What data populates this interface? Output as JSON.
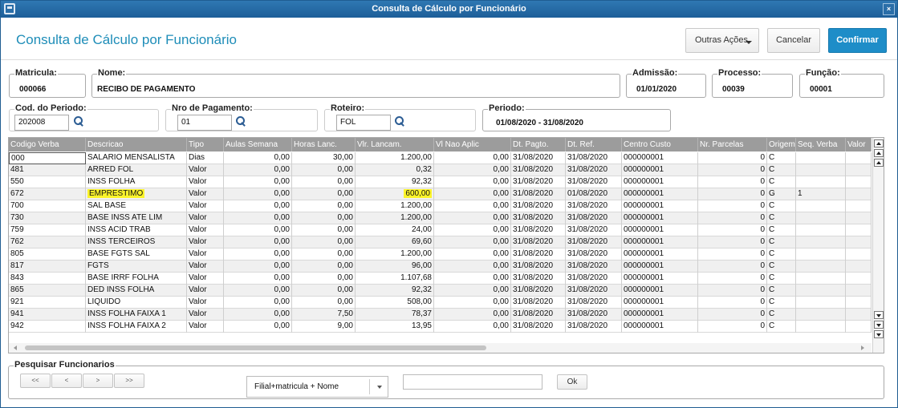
{
  "window": {
    "title": "Consulta de Cálculo por Funcionário",
    "close_glyph": "×",
    "app_icon": "window-icon"
  },
  "header": {
    "title": "Consulta de Cálculo por Funcionário",
    "outras_acoes_label": "Outras Ações",
    "cancelar_label": "Cancelar",
    "confirmar_label": "Confirmar",
    "accent_color": "#1e8dc8"
  },
  "employee": {
    "matricula": {
      "label": "Matricula:",
      "value": "000066"
    },
    "nome": {
      "label": "Nome:",
      "value": "RECIBO DE PAGAMENTO"
    },
    "admissao": {
      "label": "Admissão:",
      "value": "01/01/2020"
    },
    "processo": {
      "label": "Processo:",
      "value": "00039"
    },
    "funcao": {
      "label": "Função:",
      "value": "00001"
    }
  },
  "filters": {
    "cod_periodo": {
      "label": "Cod. do Periodo:",
      "value": "202008"
    },
    "nro_pagamento": {
      "label": "Nro de Pagamento:",
      "value": "01"
    },
    "roteiro": {
      "label": "Roteiro:",
      "value": "FOL"
    },
    "periodo": {
      "label": "Periodo:",
      "value": "01/08/2020 - 31/08/2020"
    }
  },
  "grid": {
    "columns": [
      "Codigo Verba",
      "Descricao",
      "Tipo",
      "Aulas Semana",
      "Horas Lanc.",
      "Vlr. Lancam.",
      "Vl Nao Aplic",
      "Dt. Pagto.",
      "Dt. Ref.",
      "Centro Custo",
      "Nr. Parcelas",
      "Origem",
      "Seq. Verba",
      "Valor"
    ],
    "highlight_color": "#fbf42a",
    "rows": [
      {
        "codigo": "000",
        "descricao": "SALARIO MENSALISTA",
        "tipo": "Dias",
        "aulas": "0,00",
        "horas": "30,00",
        "vlr": "1.200,00",
        "vlnao": "0,00",
        "dtpagto": "31/08/2020",
        "dtref": "31/08/2020",
        "centro": "000000001",
        "parcelas": "0",
        "origem": "C",
        "seq": "",
        "highlight": false
      },
      {
        "codigo": "481",
        "descricao": "ARRED FOL",
        "tipo": "Valor",
        "aulas": "0,00",
        "horas": "0,00",
        "vlr": "0,32",
        "vlnao": "0,00",
        "dtpagto": "31/08/2020",
        "dtref": "31/08/2020",
        "centro": "000000001",
        "parcelas": "0",
        "origem": "C",
        "seq": "",
        "highlight": false
      },
      {
        "codigo": "550",
        "descricao": "INSS FOLHA",
        "tipo": "Valor",
        "aulas": "0,00",
        "horas": "0,00",
        "vlr": "92,32",
        "vlnao": "0,00",
        "dtpagto": "31/08/2020",
        "dtref": "31/08/2020",
        "centro": "000000001",
        "parcelas": "0",
        "origem": "C",
        "seq": "",
        "highlight": false
      },
      {
        "codigo": "672",
        "descricao": "EMPRESTIMO",
        "tipo": "Valor",
        "aulas": "0,00",
        "horas": "0,00",
        "vlr": "600,00",
        "vlnao": "0,00",
        "dtpagto": "31/08/2020",
        "dtref": "01/08/2020",
        "centro": "000000001",
        "parcelas": "0",
        "origem": "G",
        "seq": "1",
        "highlight": true
      },
      {
        "codigo": "700",
        "descricao": "SAL BASE",
        "tipo": "Valor",
        "aulas": "0,00",
        "horas": "0,00",
        "vlr": "1.200,00",
        "vlnao": "0,00",
        "dtpagto": "31/08/2020",
        "dtref": "31/08/2020",
        "centro": "000000001",
        "parcelas": "0",
        "origem": "C",
        "seq": "",
        "highlight": false
      },
      {
        "codigo": "730",
        "descricao": "BASE INSS ATE LIM",
        "tipo": "Valor",
        "aulas": "0,00",
        "horas": "0,00",
        "vlr": "1.200,00",
        "vlnao": "0,00",
        "dtpagto": "31/08/2020",
        "dtref": "31/08/2020",
        "centro": "000000001",
        "parcelas": "0",
        "origem": "C",
        "seq": "",
        "highlight": false
      },
      {
        "codigo": "759",
        "descricao": "INSS ACID TRAB",
        "tipo": "Valor",
        "aulas": "0,00",
        "horas": "0,00",
        "vlr": "24,00",
        "vlnao": "0,00",
        "dtpagto": "31/08/2020",
        "dtref": "31/08/2020",
        "centro": "000000001",
        "parcelas": "0",
        "origem": "C",
        "seq": "",
        "highlight": false
      },
      {
        "codigo": "762",
        "descricao": "INSS TERCEIROS",
        "tipo": "Valor",
        "aulas": "0,00",
        "horas": "0,00",
        "vlr": "69,60",
        "vlnao": "0,00",
        "dtpagto": "31/08/2020",
        "dtref": "31/08/2020",
        "centro": "000000001",
        "parcelas": "0",
        "origem": "C",
        "seq": "",
        "highlight": false
      },
      {
        "codigo": "805",
        "descricao": "BASE FGTS SAL",
        "tipo": "Valor",
        "aulas": "0,00",
        "horas": "0,00",
        "vlr": "1.200,00",
        "vlnao": "0,00",
        "dtpagto": "31/08/2020",
        "dtref": "31/08/2020",
        "centro": "000000001",
        "parcelas": "0",
        "origem": "C",
        "seq": "",
        "highlight": false
      },
      {
        "codigo": "817",
        "descricao": "FGTS",
        "tipo": "Valor",
        "aulas": "0,00",
        "horas": "0,00",
        "vlr": "96,00",
        "vlnao": "0,00",
        "dtpagto": "31/08/2020",
        "dtref": "31/08/2020",
        "centro": "000000001",
        "parcelas": "0",
        "origem": "C",
        "seq": "",
        "highlight": false
      },
      {
        "codigo": "843",
        "descricao": "BASE IRRF FOLHA",
        "tipo": "Valor",
        "aulas": "0,00",
        "horas": "0,00",
        "vlr": "1.107,68",
        "vlnao": "0,00",
        "dtpagto": "31/08/2020",
        "dtref": "31/08/2020",
        "centro": "000000001",
        "parcelas": "0",
        "origem": "C",
        "seq": "",
        "highlight": false
      },
      {
        "codigo": "865",
        "descricao": "DED INSS FOLHA",
        "tipo": "Valor",
        "aulas": "0,00",
        "horas": "0,00",
        "vlr": "92,32",
        "vlnao": "0,00",
        "dtpagto": "31/08/2020",
        "dtref": "31/08/2020",
        "centro": "000000001",
        "parcelas": "0",
        "origem": "C",
        "seq": "",
        "highlight": false
      },
      {
        "codigo": "921",
        "descricao": "LIQUIDO",
        "tipo": "Valor",
        "aulas": "0,00",
        "horas": "0,00",
        "vlr": "508,00",
        "vlnao": "0,00",
        "dtpagto": "31/08/2020",
        "dtref": "31/08/2020",
        "centro": "000000001",
        "parcelas": "0",
        "origem": "C",
        "seq": "",
        "highlight": false
      },
      {
        "codigo": "941",
        "descricao": "INSS FOLHA FAIXA 1",
        "tipo": "Valor",
        "aulas": "0,00",
        "horas": "7,50",
        "vlr": "78,37",
        "vlnao": "0,00",
        "dtpagto": "31/08/2020",
        "dtref": "31/08/2020",
        "centro": "000000001",
        "parcelas": "0",
        "origem": "C",
        "seq": "",
        "highlight": false
      },
      {
        "codigo": "942",
        "descricao": "INSS FOLHA FAIXA 2",
        "tipo": "Valor",
        "aulas": "0,00",
        "horas": "9,00",
        "vlr": "13,95",
        "vlnao": "0,00",
        "dtpagto": "31/08/2020",
        "dtref": "31/08/2020",
        "centro": "000000001",
        "parcelas": "0",
        "origem": "C",
        "seq": "",
        "highlight": false
      }
    ]
  },
  "search": {
    "legend": "Pesquisar Funcionarios",
    "nav": [
      "<<",
      "<",
      ">",
      ">>"
    ],
    "select_value": "Filial+matricula + Nome",
    "input_value": "",
    "ok_label": "Ok"
  }
}
